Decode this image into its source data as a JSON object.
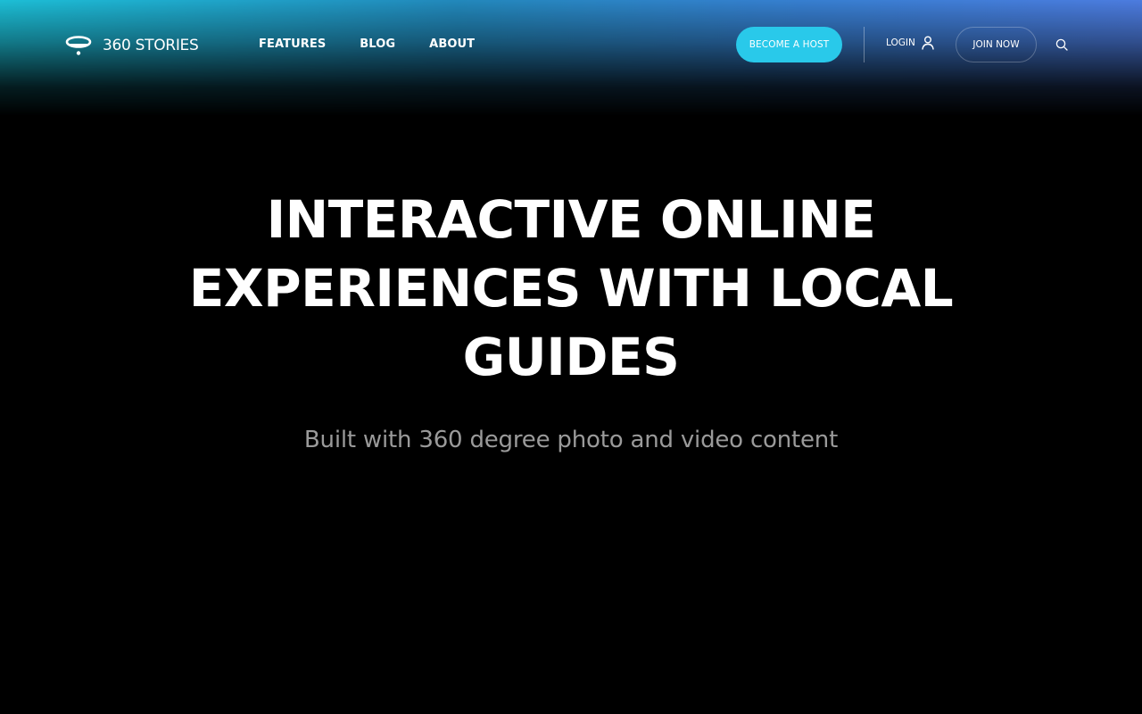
{
  "brand": {
    "logo_icon": "ufo-orb-icon",
    "name": "360 STORIES"
  },
  "nav": {
    "links": [
      {
        "label": "FEATURES"
      },
      {
        "label": "BLOG"
      },
      {
        "label": "ABOUT"
      }
    ]
  },
  "actions": {
    "become_host_label": "BECOME A HOST",
    "login_label": "LOGIN",
    "login_icon": "user-icon",
    "join_label": "JOIN NOW",
    "search_icon": "search-icon"
  },
  "hero": {
    "title": "INTERACTIVE ONLINE EXPERIENCES WITH LOCAL GUIDES",
    "subtitle": "Built with 360 degree photo and video content"
  },
  "colors": {
    "accent": "#29c9ea",
    "background": "#000000",
    "header_gradient_start": "#1ec8e1",
    "header_gradient_end": "#5082eb",
    "subtitle_text": "#9a9a9a"
  }
}
